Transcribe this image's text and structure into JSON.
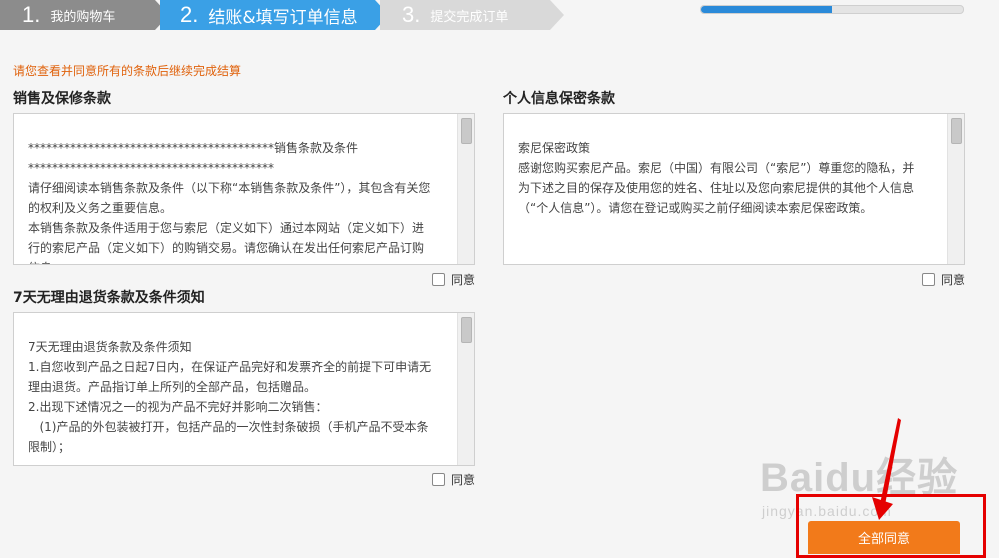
{
  "steps": [
    {
      "num": "1.",
      "label": "我的购物车"
    },
    {
      "num": "2.",
      "label": "结账&填写订单信息"
    },
    {
      "num": "3.",
      "label": "提交完成订单"
    }
  ],
  "progress": 0.5,
  "notice": "请您查看并同意所有的条款后继续完成结算",
  "sales": {
    "title": "销售及保修条款",
    "lines": [
      "*****************************************销售条款及条件",
      "*****************************************",
      "请仔细阅读本销售条款及条件（以下称“本销售条款及条件”），其包含有关您的权利及义务之重要信息。",
      "本销售条款及条件适用于您与索尼（定义如下）通过本网站（定义如下）进行的索尼产品（定义如下）的购销交易。请您确认在发出任何索尼产品订购信息"
    ],
    "agree_label": "同意"
  },
  "privacy": {
    "title": "个人信息保密条款",
    "lines": [
      "索尼保密政策",
      "",
      "感谢您购买索尼产品。索尼（中国）有限公司（“索尼”）尊重您的隐私，并为下述之目的保存及使用您的姓名、住址以及您向索尼提供的其他个人信息（“个人信息”）。请您在登记或购买之前仔细阅读本索尼保密政策。"
    ],
    "agree_label": "同意"
  },
  "returns": {
    "title": "7天无理由退货条款及条件须知",
    "lines": [
      "7天无理由退货条款及条件须知",
      "1.自您收到产品之日起7日内，在保证产品完好和发票齐全的前提下可申请无理由退货。产品指订单上所列的全部产品，包括赠品。",
      "2.出现下述情况之一的视为产品不完好并影响二次销售：",
      "   (1)产品的外包装被打开，包括产品的一次性封条破损（手机产品不受本条限制）；"
    ],
    "agree_label": "同意"
  },
  "watermark": {
    "big": "Baidu经验",
    "small": "jingyan.baidu.com"
  },
  "agree_all_label": "全部同意"
}
